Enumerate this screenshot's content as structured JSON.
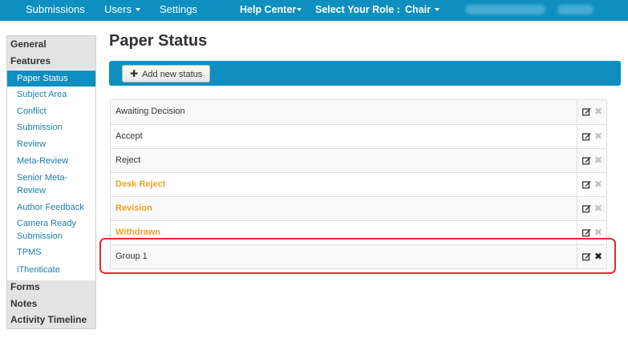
{
  "navbar": {
    "submissions": "Submissions",
    "users": "Users",
    "settings": "Settings",
    "help_center": "Help Center",
    "select_role_label": "Select Your Role :",
    "role": "Chair"
  },
  "sidebar": {
    "sections": {
      "general": "General",
      "features": "Features",
      "forms": "Forms",
      "notes": "Notes",
      "activity_timeline": "Activity Timeline"
    },
    "feature_items": [
      {
        "label": "Paper Status",
        "active": true
      },
      {
        "label": "Subject Area"
      },
      {
        "label": "Conflict"
      },
      {
        "label": "Submission"
      },
      {
        "label": "Review"
      },
      {
        "label": "Meta-Review"
      },
      {
        "label": "Senior Meta-Review"
      },
      {
        "label": "Author Feedback"
      },
      {
        "label": "Camera Ready Submission"
      },
      {
        "label": "TPMS"
      },
      {
        "label": "iThenticate"
      }
    ]
  },
  "main": {
    "title": "Paper Status",
    "add_button": "Add new status",
    "statuses": [
      {
        "name": "Awaiting Decision",
        "style": "default"
      },
      {
        "name": "Accept",
        "style": "default"
      },
      {
        "name": "Reject",
        "style": "default"
      },
      {
        "name": "Desk Reject",
        "style": "orange"
      },
      {
        "name": "Revision",
        "style": "orange"
      },
      {
        "name": "Withdrawn",
        "style": "orange"
      },
      {
        "name": "Group 1",
        "style": "default",
        "deletable": true
      }
    ]
  },
  "colors": {
    "brand": "#0e8fbf",
    "orange_status": "#f0a120",
    "highlight": "#e32c2c"
  },
  "icons": [
    "caret-down-icon",
    "plus-icon",
    "edit-icon",
    "delete-icon"
  ]
}
